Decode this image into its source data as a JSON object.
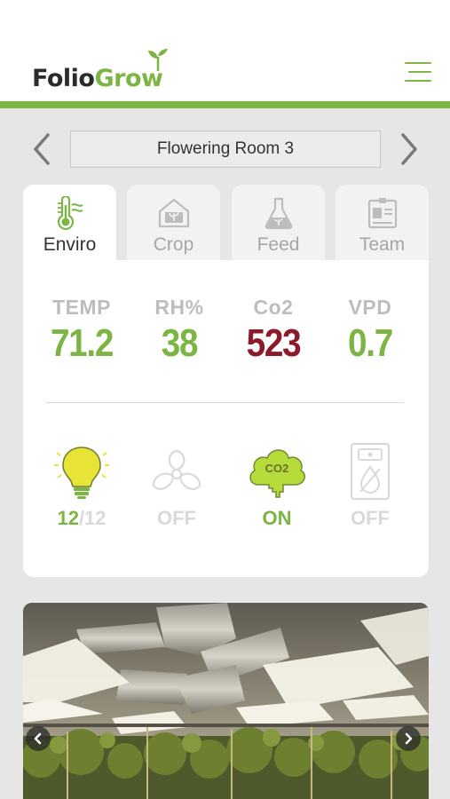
{
  "app": {
    "logo_part1": "Folio",
    "logo_part2": "Grow",
    "brand_color": "#7db544"
  },
  "room": {
    "name": "Flowering Room 3",
    "prev_icon": "chevron-left-icon",
    "next_icon": "chevron-right-icon"
  },
  "tabs": [
    {
      "label": "Enviro",
      "icon": "thermometer-icon",
      "active": true
    },
    {
      "label": "Crop",
      "icon": "greenhouse-icon",
      "active": false
    },
    {
      "label": "Feed",
      "icon": "flask-icon",
      "active": false
    },
    {
      "label": "Team",
      "icon": "id-card-icon",
      "active": false
    }
  ],
  "metrics": [
    {
      "label": "TEMP",
      "value": "71.2",
      "color": "#7db544"
    },
    {
      "label": "RH%",
      "value": "38",
      "color": "#7db544"
    },
    {
      "label": "Co2",
      "value": "523",
      "color": "#8b1a2b"
    },
    {
      "label": "VPD",
      "value": "0.7",
      "color": "#7db544"
    }
  ],
  "devices": [
    {
      "name": "lights",
      "icon": "lightbulb-icon",
      "status_on": "12",
      "status_total": "/12",
      "active": true
    },
    {
      "name": "fan",
      "icon": "fan-icon",
      "status": "OFF",
      "active": false
    },
    {
      "name": "co2",
      "icon": "co2-cloud-icon",
      "status": "ON",
      "icon_text": "CO2",
      "active": true
    },
    {
      "name": "dehumidifier",
      "icon": "dehumidifier-icon",
      "status": "OFF",
      "active": false
    }
  ],
  "photo": {
    "prev_icon": "chevron-left-icon",
    "next_icon": "chevron-right-icon"
  }
}
